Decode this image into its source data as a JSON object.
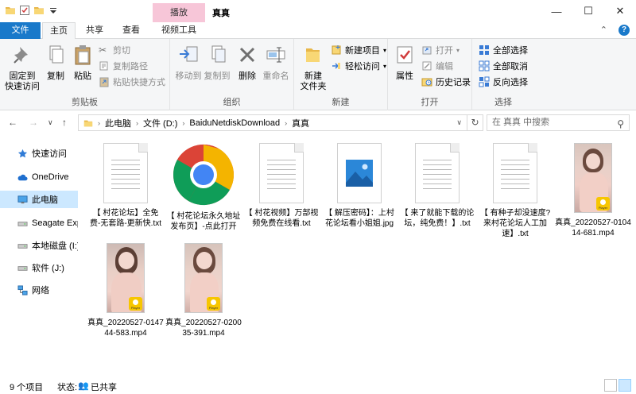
{
  "window": {
    "title": "真真",
    "context_tab": "播放",
    "minimize": "—",
    "maximize": "☐",
    "close": "✕"
  },
  "ribbon_tabs": {
    "file": "文件",
    "home": "主页",
    "share": "共享",
    "view": "查看",
    "video_tools": "视频工具",
    "collapse": "⌃",
    "help": "?"
  },
  "ribbon": {
    "clipboard": {
      "label": "剪贴板",
      "pin": "固定到\n快速访问",
      "copy": "复制",
      "paste": "粘贴",
      "cut": "剪切",
      "copy_path": "复制路径",
      "paste_shortcut": "粘贴快捷方式"
    },
    "organize": {
      "label": "组织",
      "move_to": "移动到",
      "copy_to": "复制到",
      "delete": "删除",
      "rename": "重命名"
    },
    "new": {
      "label": "新建",
      "new_folder": "新建\n文件夹",
      "new_item": "新建项目",
      "easy_access": "轻松访问"
    },
    "open": {
      "label": "打开",
      "properties": "属性",
      "open": "打开",
      "edit": "编辑",
      "history": "历史记录"
    },
    "select": {
      "label": "选择",
      "select_all": "全部选择",
      "select_none": "全部取消",
      "invert": "反向选择"
    }
  },
  "address": {
    "path": [
      "此电脑",
      "文件 (D:)",
      "BaiduNetdiskDownload",
      "真真"
    ],
    "search_placeholder": "在 真真 中搜索"
  },
  "nav_pane": {
    "items": [
      {
        "label": "快速访问",
        "icon": "star-icon"
      },
      {
        "label": "OneDrive",
        "icon": "cloud-icon"
      },
      {
        "label": "此电脑",
        "icon": "computer-icon"
      },
      {
        "label": "Seagate Expa",
        "icon": "drive-icon"
      },
      {
        "label": "本地磁盘 (I:)",
        "icon": "drive-icon"
      },
      {
        "label": "软件 (J:)",
        "icon": "drive-icon"
      },
      {
        "label": "网络",
        "icon": "network-icon"
      }
    ]
  },
  "files": [
    {
      "name": "【 村花论坛】全免费-无套路-更新快.txt",
      "type": "txt"
    },
    {
      "name": "【 村花论坛永久地址发布页】-点此打开",
      "type": "chrome"
    },
    {
      "name": "【 村花视频】万部视频免费在线看.txt",
      "type": "txt"
    },
    {
      "name": "【 解压密码】：上村花论坛看小姐姐.jpg",
      "type": "jpg"
    },
    {
      "name": "【 来了就能下载的论坛，纯免费！】.txt",
      "type": "txt"
    },
    {
      "name": "【 有种子却没速度?来村花论坛人工加速】.txt",
      "type": "txt"
    },
    {
      "name": "真真_20220527-010414-681.mp4",
      "type": "mp4"
    },
    {
      "name": "真真_20220527-014744-583.mp4",
      "type": "mp4"
    },
    {
      "name": "真真_20220527-020035-391.mp4",
      "type": "mp4"
    }
  ],
  "status": {
    "count": "9 个项目",
    "state": "状态:",
    "shared": "已共享"
  },
  "player_badge": "Player"
}
